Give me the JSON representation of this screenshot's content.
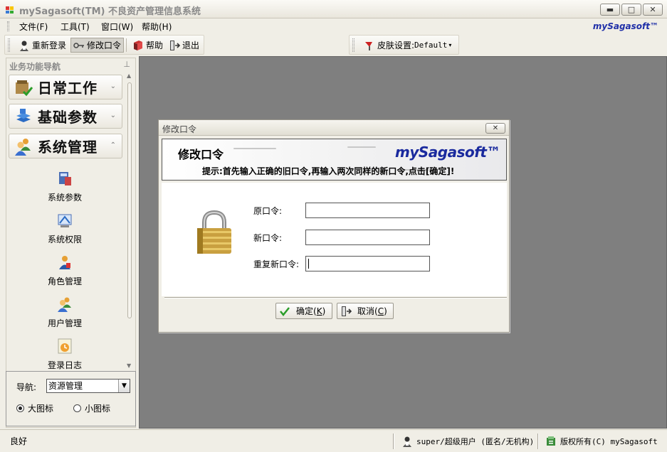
{
  "window": {
    "title": "mySagasoft(TM) 不良资产管理信息系统",
    "min_glyph": "▬",
    "max_glyph": "□",
    "close_glyph": "✕"
  },
  "menubar": {
    "items": [
      "文件(F)",
      "工具(T)",
      "窗口(W)",
      "帮助(H)"
    ],
    "brand": "mySagasoft™"
  },
  "toolbar": {
    "relogin": "重新登录",
    "change_password": "修改口令",
    "help": "帮助",
    "exit": "退出",
    "skin_label": "皮肤设置:",
    "skin_value": "Default"
  },
  "nav": {
    "title": "业务功能导航",
    "groups": [
      "日常工作",
      "基础参数",
      "系统管理"
    ],
    "subitems": [
      "系统参数",
      "系统权限",
      "角色管理",
      "用户管理",
      "登录日志"
    ],
    "nav_label": "导航:",
    "nav_select": "资源管理",
    "radio_large": "大图标",
    "radio_small": "小图标"
  },
  "dialog": {
    "title": "修改口令",
    "heading": "修改口令",
    "hint": "提示:首先输入正确的旧口令,再输入两次同样的新口令,点击[确定]!",
    "logo": "mySagasoft™",
    "fields": [
      {
        "label": "原口令:",
        "value": ""
      },
      {
        "label": "新口令:",
        "value": ""
      },
      {
        "label": "重复新口令:",
        "value": ""
      }
    ],
    "ok_label": "确定(",
    "ok_key": "K",
    "cancel_label": "取消(",
    "cancel_key": "C",
    "close_paren": ")"
  },
  "status": {
    "ready": "良好",
    "user": "super/超级用户 (匿名/无机构)",
    "copyright": "版权所有(C) mySagasoft"
  },
  "colors": {
    "workspace": "#7f7f7f",
    "brand_blue": "#1f2fa8"
  }
}
